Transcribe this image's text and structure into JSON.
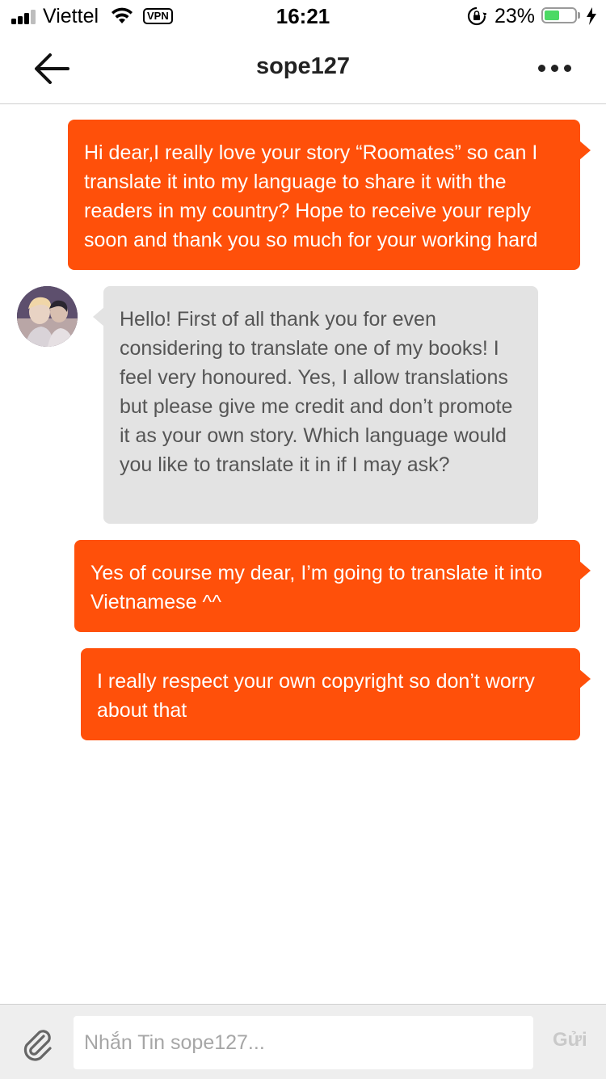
{
  "status_bar": {
    "carrier": "Viettel",
    "vpn": "VPN",
    "time": "16:21",
    "battery_percent": "23%",
    "battery_level": 0.23,
    "wifi_icon": "wifi-icon",
    "lock_icon": "orientation-lock-icon",
    "charging_icon": "bolt-icon"
  },
  "nav": {
    "title": "sope127",
    "back_icon": "arrow-left-icon",
    "more_icon": "more-horizontal-icon"
  },
  "messages": [
    {
      "direction": "outgoing",
      "text": "Hi dear,I really love your story “Roomates” so can I translate it into my language to share it with the readers in my country? Hope to receive your reply soon and thank you so much for your working hard"
    },
    {
      "direction": "incoming",
      "text": "Hello! First of all thank you for even considering to translate one of my books! I feel very honoured. Yes, I allow translations but please give me credit and don’t promote it as your own story. Which language would you like to translate it in if I may ask?"
    },
    {
      "direction": "outgoing",
      "text": "Yes of course my dear, I’m going to translate it into Vietnamese ^^"
    },
    {
      "direction": "outgoing",
      "text": "I really respect your own copyright so don’t worry about that"
    }
  ],
  "composer": {
    "placeholder": "Nhắn Tin sope127...",
    "send_label": "Gửi",
    "attach_icon": "paperclip-icon"
  },
  "colors": {
    "accent": "#ff500a",
    "incoming_bubble": "#e3e3e3"
  }
}
